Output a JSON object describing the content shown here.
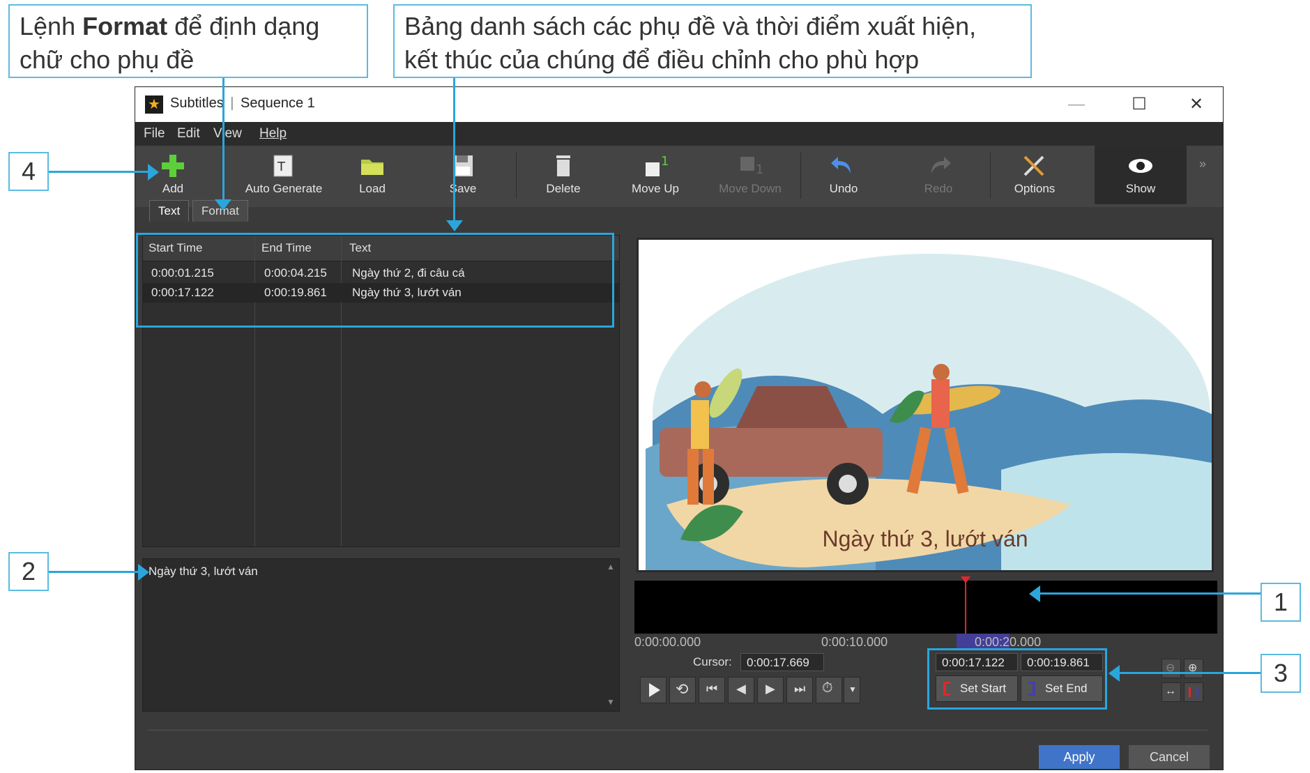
{
  "callouts": {
    "format_pre": "Lệnh ",
    "format_bold": "Format",
    "format_post1": " để định dạng",
    "format_line2": "chữ cho phụ đề",
    "list_line1": "Bảng danh sách các phụ đề và thời điểm xuất hiện,",
    "list_line2": "kết thúc của chúng để điều chỉnh cho phù hợp",
    "n1": "1",
    "n2": "2",
    "n3": "3",
    "n4": "4"
  },
  "window": {
    "app": "Subtitles",
    "title": "Sequence 1",
    "minimize": "—",
    "maximize": "☐",
    "close": "✕"
  },
  "menu": [
    "File",
    "Edit",
    "View",
    "Help"
  ],
  "toolbar": {
    "add": "Add",
    "auto_generate": "Auto Generate",
    "load": "Load",
    "save": "Save",
    "delete": "Delete",
    "move_up": "Move Up",
    "move_down": "Move Down",
    "undo": "Undo",
    "redo": "Redo",
    "options": "Options",
    "show": "Show"
  },
  "tabs": {
    "text": "Text",
    "format": "Format"
  },
  "list": {
    "columns": [
      "Start Time",
      "End Time",
      "Text"
    ],
    "rows": [
      {
        "start": "0:00:01.215",
        "end": "0:00:04.215",
        "text": "Ngày thứ 2, đi câu cá"
      },
      {
        "start": "0:00:17.122",
        "end": "0:00:19.861",
        "text": "Ngày thứ 3, lướt ván"
      }
    ]
  },
  "editor": {
    "text": "Ngày thứ 3, lướt ván"
  },
  "preview": {
    "caption": "Ngày thứ 3, lướt ván"
  },
  "ruler": {
    "t0": "0:00:00.000",
    "t10": "0:00:10.000",
    "t20": "0:00:20.000"
  },
  "playback": {
    "cursor_label": "Cursor:",
    "cursor_value": "0:00:17.669",
    "start_value": "0:00:17.122",
    "end_value": "0:00:19.861",
    "set_start": "Set Start",
    "set_end": "Set End"
  },
  "footer": {
    "apply": "Apply",
    "cancel": "Cancel"
  },
  "colors": {
    "accent": "#2aa6dc",
    "apply": "#3f74c9",
    "window_bg": "#3a3a3a"
  }
}
